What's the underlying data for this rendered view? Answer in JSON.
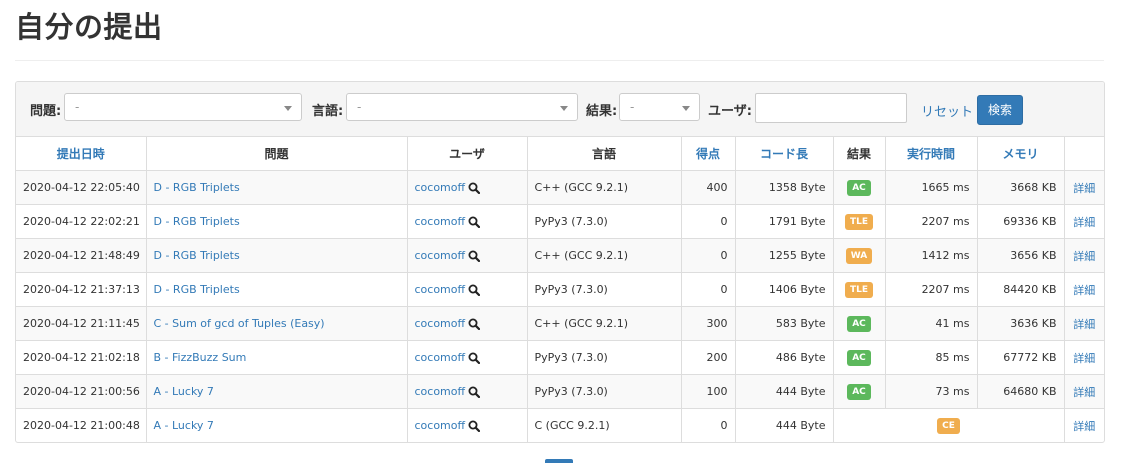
{
  "page": {
    "title": "自分の提出"
  },
  "filters": {
    "problem_label": "問題:",
    "problem_value": "-",
    "language_label": "言語:",
    "language_value": "-",
    "result_label": "結果:",
    "result_value": "-",
    "user_label": "ユーザ:",
    "user_value": "",
    "reset_label": "リセット",
    "search_label": "検索"
  },
  "table": {
    "headers": [
      "提出日時",
      "問題",
      "ユーザ",
      "言語",
      "得点",
      "コード長",
      "結果",
      "実行時間",
      "メモリ",
      ""
    ],
    "rows": [
      {
        "date": "2020-04-12 22:05:40",
        "task": "D - RGB Triplets",
        "user": "cocomoff",
        "lang": "C++ (GCC 9.2.1)",
        "score": "400",
        "size": "1358 Byte",
        "status": "AC",
        "time": "1665 ms",
        "memory": "3668 KB",
        "detail": "詳細"
      },
      {
        "date": "2020-04-12 22:02:21",
        "task": "D - RGB Triplets",
        "user": "cocomoff",
        "lang": "PyPy3 (7.3.0)",
        "score": "0",
        "size": "1791 Byte",
        "status": "TLE",
        "time": "2207 ms",
        "memory": "69336 KB",
        "detail": "詳細"
      },
      {
        "date": "2020-04-12 21:48:49",
        "task": "D - RGB Triplets",
        "user": "cocomoff",
        "lang": "C++ (GCC 9.2.1)",
        "score": "0",
        "size": "1255 Byte",
        "status": "WA",
        "time": "1412 ms",
        "memory": "3656 KB",
        "detail": "詳細"
      },
      {
        "date": "2020-04-12 21:37:13",
        "task": "D - RGB Triplets",
        "user": "cocomoff",
        "lang": "PyPy3 (7.3.0)",
        "score": "0",
        "size": "1406 Byte",
        "status": "TLE",
        "time": "2207 ms",
        "memory": "84420 KB",
        "detail": "詳細"
      },
      {
        "date": "2020-04-12 21:11:45",
        "task": "C - Sum of gcd of Tuples (Easy)",
        "user": "cocomoff",
        "lang": "C++ (GCC 9.2.1)",
        "score": "300",
        "size": "583 Byte",
        "status": "AC",
        "time": "41 ms",
        "memory": "3636 KB",
        "detail": "詳細"
      },
      {
        "date": "2020-04-12 21:02:18",
        "task": "B - FizzBuzz Sum",
        "user": "cocomoff",
        "lang": "PyPy3 (7.3.0)",
        "score": "200",
        "size": "486 Byte",
        "status": "AC",
        "time": "85 ms",
        "memory": "67772 KB",
        "detail": "詳細"
      },
      {
        "date": "2020-04-12 21:00:56",
        "task": "A - Lucky 7",
        "user": "cocomoff",
        "lang": "PyPy3 (7.3.0)",
        "score": "100",
        "size": "444 Byte",
        "status": "AC",
        "time": "73 ms",
        "memory": "64680 KB",
        "detail": "詳細"
      },
      {
        "date": "2020-04-12 21:00:48",
        "task": "A - Lucky 7",
        "user": "cocomoff",
        "lang": "C (GCC 9.2.1)",
        "score": "0",
        "size": "444 Byte",
        "status": "CE",
        "time": "",
        "memory": "",
        "detail": "詳細"
      }
    ]
  },
  "status_colors": {
    "AC": "#5cb85c",
    "TLE": "#f0ad4e",
    "WA": "#f0ad4e",
    "CE": "#f0ad4e"
  },
  "icons": {
    "user_search": "magnifier-icon",
    "dropdown": "caret-down-icon"
  }
}
